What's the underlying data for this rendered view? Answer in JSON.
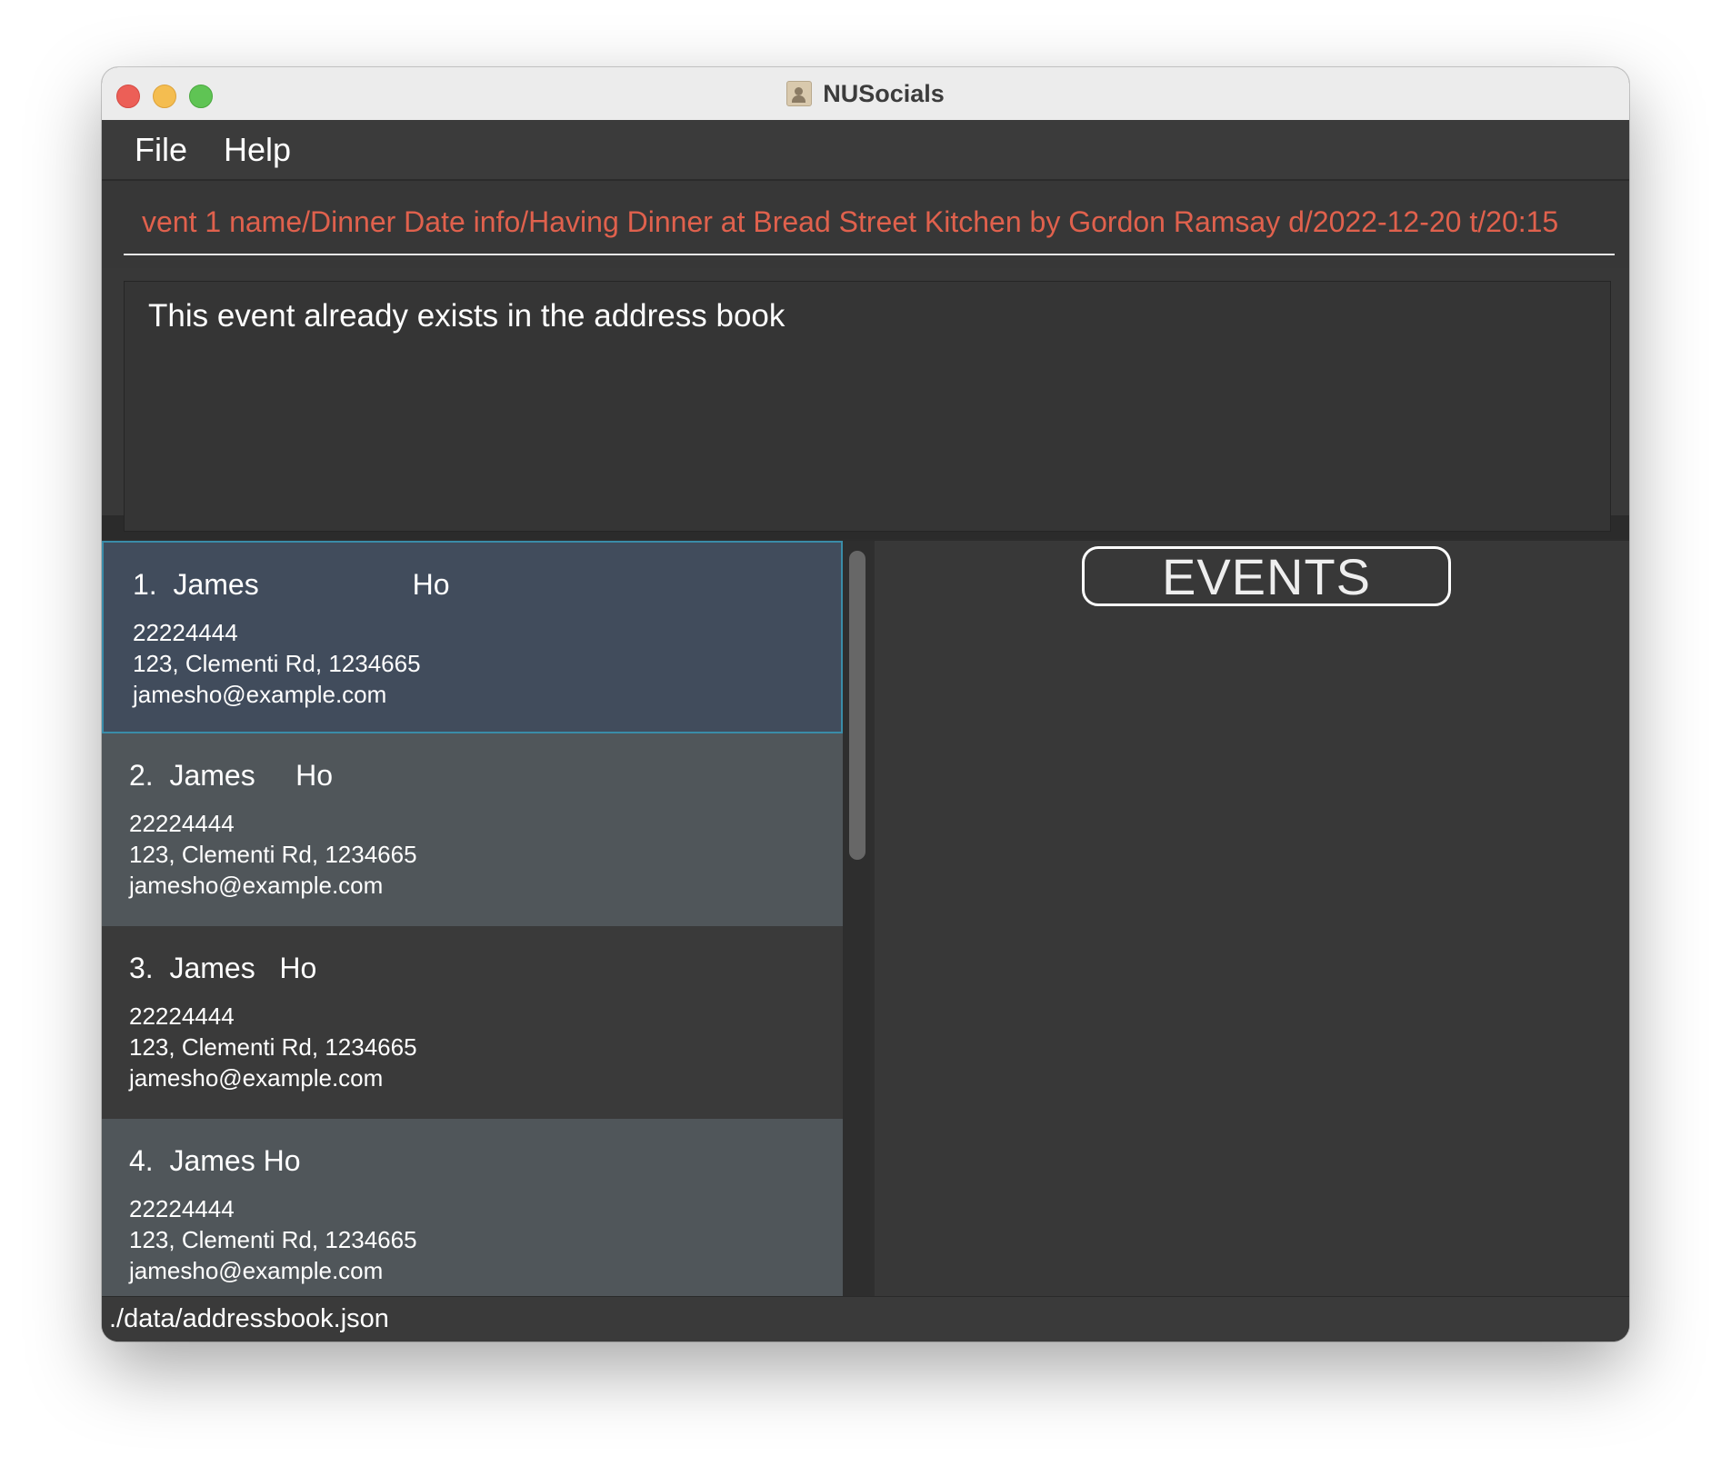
{
  "window": {
    "title": "NUSocials"
  },
  "menu": {
    "items": [
      {
        "label": "File"
      },
      {
        "label": "Help"
      }
    ]
  },
  "command": {
    "value": "vent 1 name/Dinner Date info/Having Dinner at Bread Street Kitchen by Gordon Ramsay d/2022-12-20 t/20:15"
  },
  "result": {
    "text": "This event already exists in the address book"
  },
  "persons": [
    {
      "index": "1.",
      "name": "James                   Ho",
      "phone": "22224444",
      "address": "123, Clementi Rd, 1234665",
      "email": "jamesho@example.com"
    },
    {
      "index": "2.",
      "name": "James     Ho",
      "phone": "22224444",
      "address": "123, Clementi Rd, 1234665",
      "email": "jamesho@example.com"
    },
    {
      "index": "3.",
      "name": "James   Ho",
      "phone": "22224444",
      "address": "123, Clementi Rd, 1234665",
      "email": "jamesho@example.com"
    },
    {
      "index": "4.",
      "name": "James Ho",
      "phone": "22224444",
      "address": "123, Clementi Rd, 1234665",
      "email": "jamesho@example.com"
    }
  ],
  "events": {
    "title": "EVENTS"
  },
  "status": {
    "path": "./data/addressbook.json"
  },
  "colors": {
    "command_text": "#e0614d",
    "selected_card": "#414c5c",
    "selected_border": "#3a8ca8",
    "card_even": "#50565a",
    "card_odd": "#3a3a3a"
  }
}
